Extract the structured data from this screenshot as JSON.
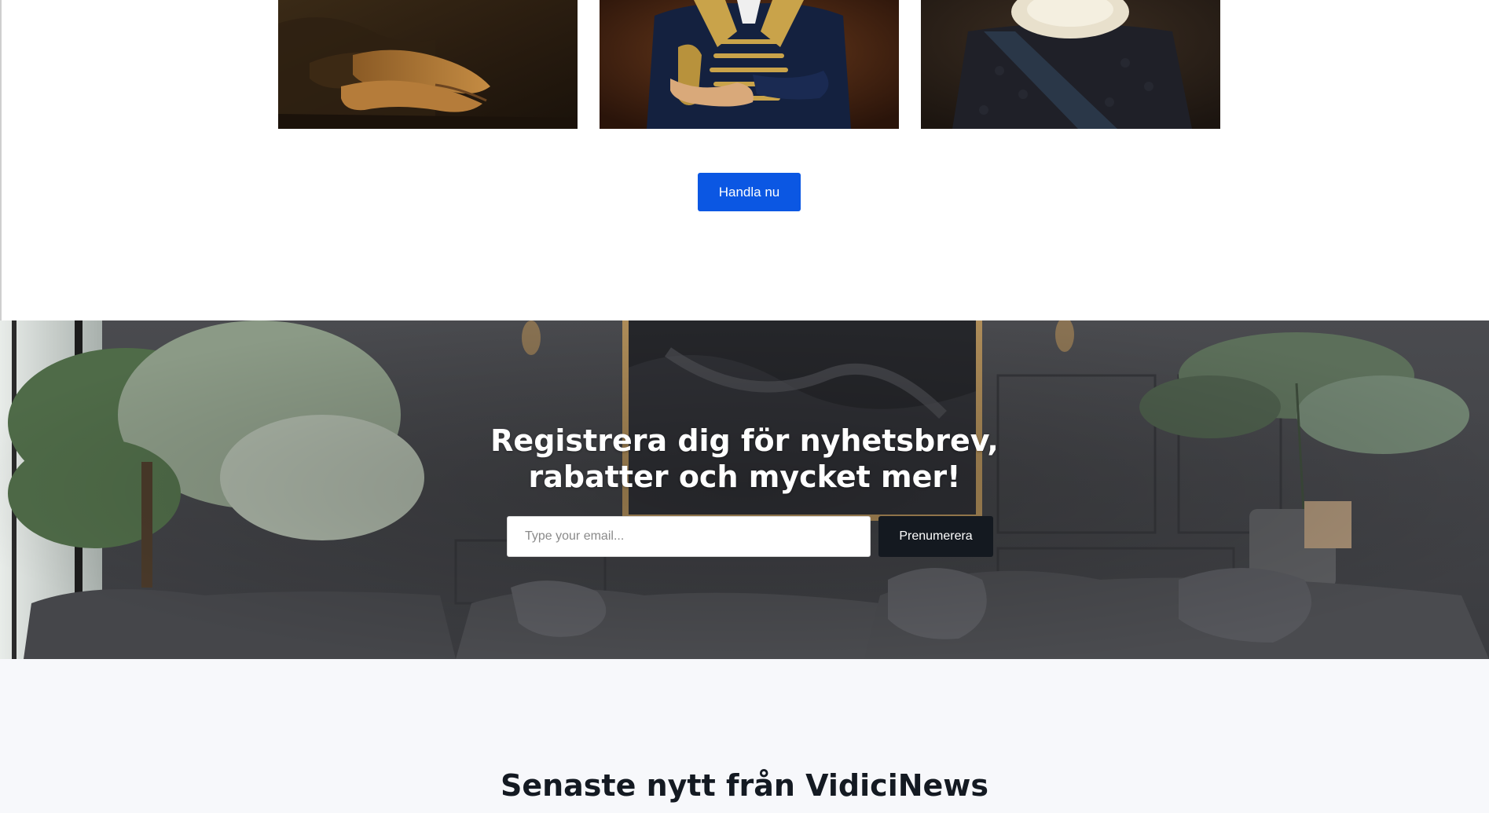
{
  "products": [
    {
      "icon": "painting-mona-lisa"
    },
    {
      "icon": "painting-military-portrait"
    },
    {
      "icon": "painting-ruff-collar-portrait"
    }
  ],
  "cta": {
    "label": "Handla nu",
    "color": "#0b57e3"
  },
  "newsletter": {
    "title_line1": "Registrera dig för nyhetsbrev,",
    "title_line2": "rabatter och mycket mer!",
    "email_placeholder": "Type your email...",
    "subscribe_label": "Prenumerera",
    "button_color": "#141920",
    "background_icon": "living-room-photo"
  },
  "news": {
    "title": "Senaste nytt från VidiciNews"
  }
}
